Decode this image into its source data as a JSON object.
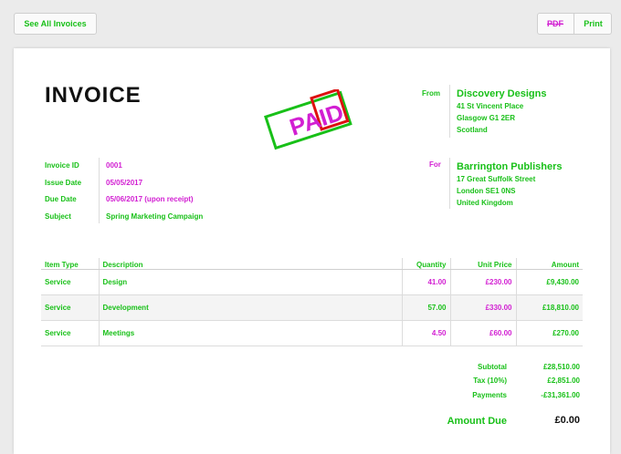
{
  "toolbar": {
    "see_all_label": "See All Invoices",
    "pdf_label": "PDF",
    "print_label": "Print"
  },
  "invoice": {
    "title": "INVOICE",
    "stamp_text": "PAID",
    "from": {
      "label": "From",
      "name": "Discovery Designs",
      "address": [
        "41 St Vincent Place",
        "Glasgow G1 2ER",
        "Scotland"
      ]
    },
    "for": {
      "label": "For",
      "name": "Barrington Publishers",
      "address": [
        "17 Great Suffolk Street",
        "London SE1 0NS",
        "United Kingdom"
      ]
    },
    "meta": [
      {
        "label": "Invoice ID",
        "value": "0001"
      },
      {
        "label": "Issue Date",
        "value": "05/05/2017"
      },
      {
        "label": "Due Date",
        "value": "05/06/2017 (upon receipt)"
      },
      {
        "label": "Subject",
        "value": "Spring Marketing Campaign"
      }
    ],
    "columns": [
      "Item Type",
      "Description",
      "Quantity",
      "Unit Price",
      "Amount"
    ],
    "items": [
      {
        "type": "Service",
        "description": "Design",
        "quantity": "41.00",
        "unit_price": "£230.00",
        "amount": "£9,430.00"
      },
      {
        "type": "Service",
        "description": "Development",
        "quantity": "57.00",
        "unit_price": "£330.00",
        "amount": "£18,810.00"
      },
      {
        "type": "Service",
        "description": "Meetings",
        "quantity": "4.50",
        "unit_price": "£60.00",
        "amount": "£270.00"
      }
    ],
    "totals": [
      {
        "label": "Subtotal",
        "value": "£28,510.00"
      },
      {
        "label": "Tax (10%)",
        "value": "£2,851.00"
      },
      {
        "label": "Payments",
        "value": "-£31,361.00"
      }
    ],
    "amount_due_label": "Amount Due",
    "amount_due_value": "£0.00"
  }
}
